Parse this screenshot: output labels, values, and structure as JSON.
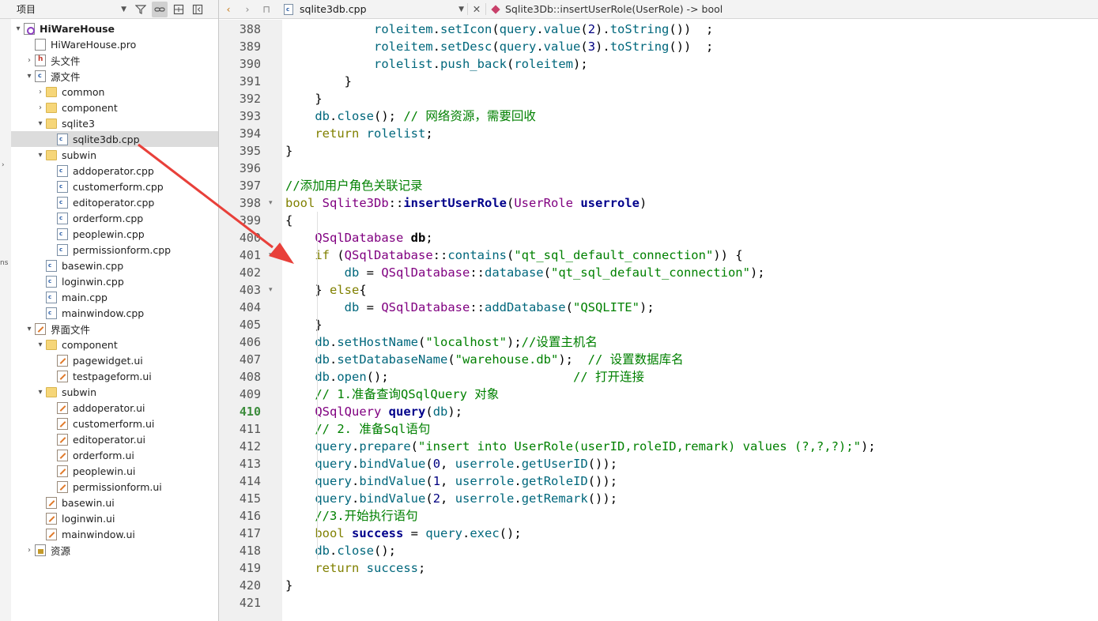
{
  "project_pane": {
    "selector_label": "项目",
    "tree": [
      {
        "label": "HiWareHouse",
        "depth": 0,
        "arrow": "▾",
        "icon": "proj",
        "bold": true
      },
      {
        "label": "HiWareHouse.pro",
        "depth": 1,
        "arrow": "",
        "icon": "file"
      },
      {
        "label": "头文件",
        "depth": 1,
        "arrow": "›",
        "icon": "hdr"
      },
      {
        "label": "源文件",
        "depth": 1,
        "arrow": "▾",
        "icon": "srcgrp"
      },
      {
        "label": "common",
        "depth": 2,
        "arrow": "›",
        "icon": "folder"
      },
      {
        "label": "component",
        "depth": 2,
        "arrow": "›",
        "icon": "folder"
      },
      {
        "label": "sqlite3",
        "depth": 2,
        "arrow": "▾",
        "icon": "folder"
      },
      {
        "label": "sqlite3db.cpp",
        "depth": 3,
        "arrow": "",
        "icon": "cpp",
        "selected": true
      },
      {
        "label": "subwin",
        "depth": 2,
        "arrow": "▾",
        "icon": "folder"
      },
      {
        "label": "addoperator.cpp",
        "depth": 3,
        "arrow": "",
        "icon": "cpp"
      },
      {
        "label": "customerform.cpp",
        "depth": 3,
        "arrow": "",
        "icon": "cpp"
      },
      {
        "label": "editoperator.cpp",
        "depth": 3,
        "arrow": "",
        "icon": "cpp"
      },
      {
        "label": "orderform.cpp",
        "depth": 3,
        "arrow": "",
        "icon": "cpp"
      },
      {
        "label": "peoplewin.cpp",
        "depth": 3,
        "arrow": "",
        "icon": "cpp"
      },
      {
        "label": "permissionform.cpp",
        "depth": 3,
        "arrow": "",
        "icon": "cpp"
      },
      {
        "label": "basewin.cpp",
        "depth": 2,
        "arrow": "",
        "icon": "cpp"
      },
      {
        "label": "loginwin.cpp",
        "depth": 2,
        "arrow": "",
        "icon": "cpp"
      },
      {
        "label": "main.cpp",
        "depth": 2,
        "arrow": "",
        "icon": "cpp"
      },
      {
        "label": "mainwindow.cpp",
        "depth": 2,
        "arrow": "",
        "icon": "cpp"
      },
      {
        "label": "界面文件",
        "depth": 1,
        "arrow": "▾",
        "icon": "ui"
      },
      {
        "label": "component",
        "depth": 2,
        "arrow": "▾",
        "icon": "folder"
      },
      {
        "label": "pagewidget.ui",
        "depth": 3,
        "arrow": "",
        "icon": "ui"
      },
      {
        "label": "testpageform.ui",
        "depth": 3,
        "arrow": "",
        "icon": "ui"
      },
      {
        "label": "subwin",
        "depth": 2,
        "arrow": "▾",
        "icon": "folder"
      },
      {
        "label": "addoperator.ui",
        "depth": 3,
        "arrow": "",
        "icon": "ui"
      },
      {
        "label": "customerform.ui",
        "depth": 3,
        "arrow": "",
        "icon": "ui"
      },
      {
        "label": "editoperator.ui",
        "depth": 3,
        "arrow": "",
        "icon": "ui"
      },
      {
        "label": "orderform.ui",
        "depth": 3,
        "arrow": "",
        "icon": "ui"
      },
      {
        "label": "peoplewin.ui",
        "depth": 3,
        "arrow": "",
        "icon": "ui"
      },
      {
        "label": "permissionform.ui",
        "depth": 3,
        "arrow": "",
        "icon": "ui"
      },
      {
        "label": "basewin.ui",
        "depth": 2,
        "arrow": "",
        "icon": "ui"
      },
      {
        "label": "loginwin.ui",
        "depth": 2,
        "arrow": "",
        "icon": "ui"
      },
      {
        "label": "mainwindow.ui",
        "depth": 2,
        "arrow": "",
        "icon": "ui"
      },
      {
        "label": "资源",
        "depth": 1,
        "arrow": "›",
        "icon": "res"
      }
    ]
  },
  "left_gutter_text": "ns",
  "editor": {
    "file_name": "sqlite3db.cpp",
    "symbol": "Sqlite3Db::insertUserRole(UserRole) -> bool",
    "current_line": 410,
    "lines": [
      {
        "n": 388,
        "code": "            <span class=\"fn\">roleitem</span>.<span class=\"fn\">setIcon</span>(<span class=\"fn\">query</span>.<span class=\"fn\">value</span>(<span class=\"nu\">2</span>).<span class=\"fn\">toString</span>())  ;"
      },
      {
        "n": 389,
        "code": "            <span class=\"fn\">roleitem</span>.<span class=\"fn\">setDesc</span>(<span class=\"fn\">query</span>.<span class=\"fn\">value</span>(<span class=\"nu\">3</span>).<span class=\"fn\">toString</span>())  ;"
      },
      {
        "n": 390,
        "code": "            <span class=\"fn\">rolelist</span>.<span class=\"fn\">push_back</span>(<span class=\"fn\">roleitem</span>);"
      },
      {
        "n": 391,
        "code": "        }"
      },
      {
        "n": 392,
        "code": "    }"
      },
      {
        "n": 393,
        "code": "    <span class=\"fn\">db</span>.<span class=\"fn\">close</span>(); <span class=\"cm\">// 网络资源，需要回收</span>"
      },
      {
        "n": 394,
        "code": "    <span class=\"kw\">return</span> <span class=\"fn\">rolelist</span>;"
      },
      {
        "n": 395,
        "code": "}"
      },
      {
        "n": 396,
        "code": ""
      },
      {
        "n": 397,
        "code": "<span class=\"cm\">//添加用户角色关联记录</span>"
      },
      {
        "n": 398,
        "code": "<span class=\"kw\">bool</span> <span class=\"ty\">Sqlite3Db</span>::<span class=\"bd\">insertUserRole</span>(<span class=\"ty\">UserRole</span> <span class=\"bd\">userrole</span>)",
        "fold": true
      },
      {
        "n": 399,
        "code": "{"
      },
      {
        "n": 400,
        "code": "    <span class=\"ty\">QSqlDatabase</span> <span class=\"bb\">db</span>;"
      },
      {
        "n": 401,
        "code": "    <span class=\"kw\">if</span> (<span class=\"ty\">QSqlDatabase</span>::<span class=\"fn\">contains</span>(<span class=\"st\">\"qt_sql_default_connection\"</span>)) {",
        "fold": true
      },
      {
        "n": 402,
        "code": "        <span class=\"fn\">db</span> = <span class=\"ty\">QSqlDatabase</span>::<span class=\"fn\">database</span>(<span class=\"st\">\"qt_sql_default_connection\"</span>);"
      },
      {
        "n": 403,
        "code": "    } <span class=\"kw\">else</span>{",
        "fold": true
      },
      {
        "n": 404,
        "code": "        <span class=\"fn\">db</span> = <span class=\"ty\">QSqlDatabase</span>::<span class=\"fn\">addDatabase</span>(<span class=\"st\">\"QSQLITE\"</span>);"
      },
      {
        "n": 405,
        "code": "    }"
      },
      {
        "n": 406,
        "code": "    <span class=\"fn\">db</span>.<span class=\"fn\">setHostName</span>(<span class=\"st\">\"localhost\"</span>);<span class=\"cm\">//设置主机名</span>"
      },
      {
        "n": 407,
        "code": "    <span class=\"fn\">db</span>.<span class=\"fn\">setDatabaseName</span>(<span class=\"st\">\"warehouse.db\"</span>);  <span class=\"cm\">// 设置数据库名</span>"
      },
      {
        "n": 408,
        "code": "    <span class=\"fn\">db</span>.<span class=\"fn\">open</span>();                         <span class=\"cm\">// 打开连接</span>"
      },
      {
        "n": 409,
        "code": "    <span class=\"cm\">// 1.准备查询QSqlQuery 对象</span>"
      },
      {
        "n": 410,
        "code": "    <span class=\"ty\">QSqlQuery</span> <span class=\"bd\">query</span>(<span class=\"fn\">db</span>);"
      },
      {
        "n": 411,
        "code": "    <span class=\"cm\">// 2. 准备Sql语句</span>"
      },
      {
        "n": 412,
        "code": "    <span class=\"fn\">query</span>.<span class=\"fn\">prepare</span>(<span class=\"st\">\"insert into UserRole(userID,roleID,remark) values (?,?,?);\"</span>);"
      },
      {
        "n": 413,
        "code": "    <span class=\"fn\">query</span>.<span class=\"fn\">bindValue</span>(<span class=\"nu\">0</span>, <span class=\"fn\">userrole</span>.<span class=\"fn\">getUserID</span>());"
      },
      {
        "n": 414,
        "code": "    <span class=\"fn\">query</span>.<span class=\"fn\">bindValue</span>(<span class=\"nu\">1</span>, <span class=\"fn\">userrole</span>.<span class=\"fn\">getRoleID</span>());"
      },
      {
        "n": 415,
        "code": "    <span class=\"fn\">query</span>.<span class=\"fn\">bindValue</span>(<span class=\"nu\">2</span>, <span class=\"fn\">userrole</span>.<span class=\"fn\">getRemark</span>());"
      },
      {
        "n": 416,
        "code": "    <span class=\"cm\">//3.开始执行语句</span>"
      },
      {
        "n": 417,
        "code": "    <span class=\"kw\">bool</span> <span class=\"bd\">success</span> = <span class=\"fn\">query</span>.<span class=\"fn\">exec</span>();"
      },
      {
        "n": 418,
        "code": "    <span class=\"fn\">db</span>.<span class=\"fn\">close</span>();"
      },
      {
        "n": 419,
        "code": "    <span class=\"kw\">return</span> <span class=\"fn\">success</span>;"
      },
      {
        "n": 420,
        "code": "}"
      },
      {
        "n": 421,
        "code": ""
      }
    ]
  },
  "colors": {
    "annotation_arrow": "#e8403a",
    "current_line_number": "#3c8c3c"
  }
}
